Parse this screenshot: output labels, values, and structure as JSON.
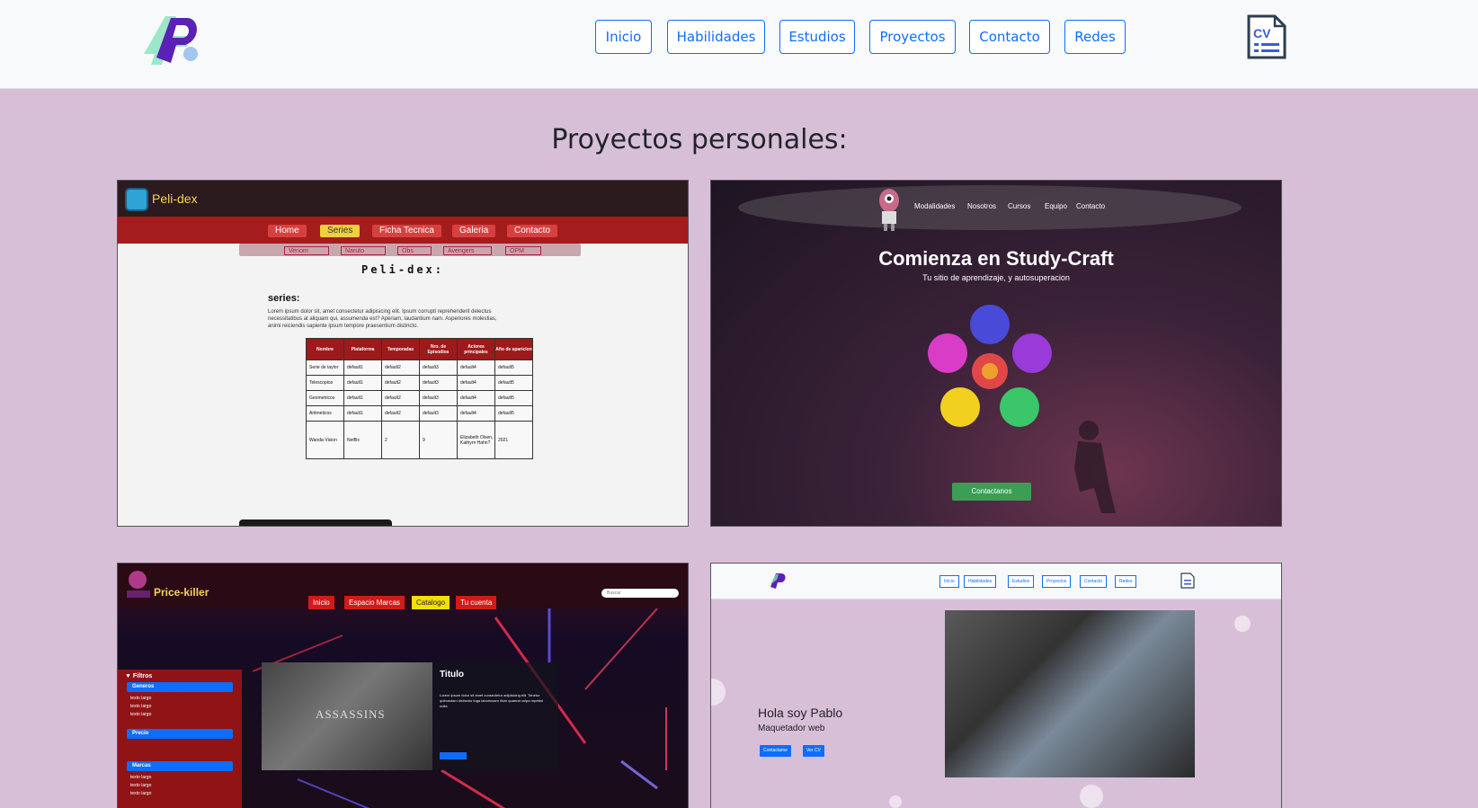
{
  "nav": {
    "items": [
      "Inicio",
      "Habilidades",
      "Estudios",
      "Proyectos",
      "Contacto",
      "Redes"
    ],
    "cv_label": "CV"
  },
  "section": {
    "title": "Proyectos personales:"
  },
  "colors": {
    "background": "#d8bfd8",
    "accent": "#0d6efd",
    "header_bg": "#f8f9fa"
  },
  "projects": [
    {
      "site_name": "Peli-dex",
      "nav": [
        "Home",
        "Series",
        "Ficha Tecnica",
        "Galeria",
        "Contacto"
      ],
      "subnav": [
        "Venom",
        "Naruto",
        "Obs",
        "Avengers",
        "OPM"
      ],
      "heading": "Peli-dex:",
      "subheading": "series:",
      "paragraph": "Lorem ipsum dolor sit, amet consectetur adipisicing elit. Ipsum corrupti reprehenderit delectus necessitatibus at aliquam qui, assumenda est? Aperiam, laudantium nam. Asperiores molestias, animi reiciendis sapiente ipsum tempore praesentium distincto.",
      "table_headers": [
        "Nombre",
        "Plataforma",
        "Temporadas",
        "Nro. de Episodios",
        "Actores principales",
        "Año de aparicion"
      ],
      "table_rows": [
        [
          "Serie de taylor",
          "default1",
          "default2",
          "default3",
          "default4",
          "default5"
        ],
        [
          "Telescopios",
          "default1",
          "default2",
          "default3",
          "default4",
          "default5"
        ],
        [
          "Geometricos",
          "default1",
          "default2",
          "default3",
          "default4",
          "default5"
        ],
        [
          "Aritmeticos",
          "default1",
          "default2",
          "default3",
          "default4",
          "default5"
        ],
        [
          "Wanda-Vision",
          "Netflix",
          "2",
          "9",
          "Elizabeth Olsen, Kathyrn Hahn?",
          "2021"
        ]
      ]
    },
    {
      "nav": [
        "Modalidades",
        "Nosotros",
        "Cursos",
        "Equipo",
        "Contacto"
      ],
      "heading": "Comienza en Study-Craft",
      "subheading": "Tu sitio de aprendizaje, y autosuperacion",
      "button": "Contactanos"
    },
    {
      "site_name": "Price-killer",
      "nav": [
        "Inicio",
        "Espacio Marcas",
        "Catalogo",
        "Tu cuenta"
      ],
      "search_placeholder": "Buscar",
      "filters_title": "▼ Filtros",
      "filter_groups": [
        "Generos",
        "Precio",
        "Marcas"
      ],
      "filter_item": "texto largo",
      "image_text": "ASSASSINS",
      "card_title": "Titulo",
      "card_text": "Lorem ipsum dolor sit amet consectetur adipisicing elit. Tenetur quibusdam distinctio fuga laboriosam illum quaerat culpa repellat nulla."
    },
    {
      "nav": [
        "Inicio",
        "Habilidades",
        "Estudios",
        "Proyectos",
        "Contacto",
        "Redes"
      ],
      "heading": "Hola soy Pablo",
      "subheading": "Maquetador web",
      "buttons": [
        "Contactame",
        "Ver CV"
      ]
    }
  ]
}
